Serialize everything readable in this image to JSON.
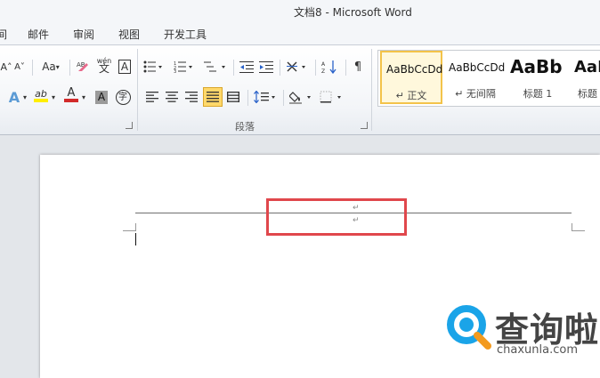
{
  "window": {
    "title": "文档8 - Microsoft Word"
  },
  "menu": {
    "tabs": [
      {
        "label": "间"
      },
      {
        "label": "邮件"
      },
      {
        "label": "审阅"
      },
      {
        "label": "视图"
      },
      {
        "label": "开发工具"
      }
    ]
  },
  "ribbon": {
    "paragraph_group_label": "段落",
    "font_buttons": {
      "font_size_menu": "Aa",
      "highlight_letters": "ab",
      "font_color_letter": "A",
      "char_shading_letter": "A",
      "enclose_char": "字",
      "wen": "wén",
      "wen_char": "文"
    },
    "styles": [
      {
        "sample": "AaBbCcDd",
        "name": "↵ 正文",
        "active": true
      },
      {
        "sample": "AaBbCcDd",
        "name": "↵ 无间隔",
        "active": false
      },
      {
        "sample": "AaBb",
        "name": "标题 1",
        "active": false
      },
      {
        "sample": "AaI",
        "name": "标题",
        "active": false
      }
    ]
  },
  "document": {
    "paragraph_marks": [
      "↵",
      "↵"
    ]
  },
  "watermark": {
    "name": "查询啦",
    "url": "chaxunla.com"
  },
  "colors": {
    "highlight_box": "#e0474c",
    "active_style_border": "#f3c34a",
    "font_color_red": "#d22a2a",
    "highlight_yellow": "#ffee00",
    "logo_blue": "#1aa4e8",
    "logo_orange": "#f39a1e"
  }
}
